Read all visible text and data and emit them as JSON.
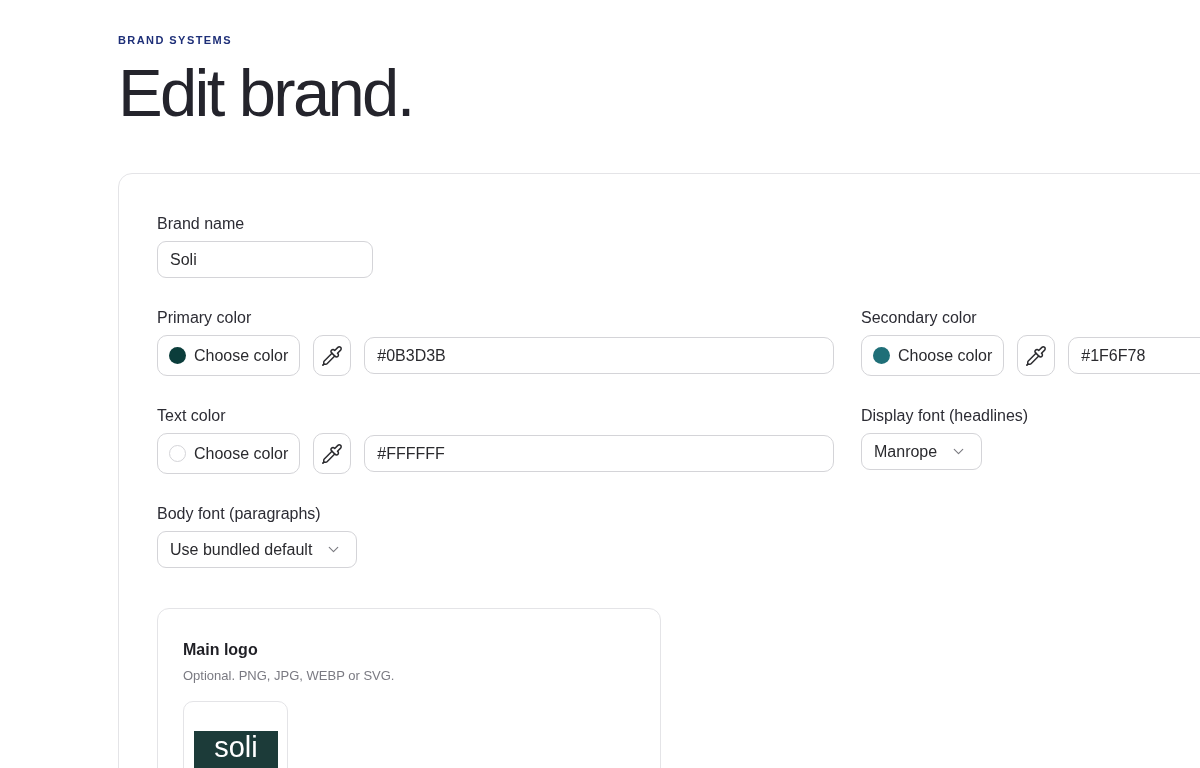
{
  "header": {
    "eyebrow": "BRAND SYSTEMS",
    "title": "Edit brand."
  },
  "form": {
    "rows": [
      [
        {
          "kind": "text",
          "label": "Brand name",
          "value": "Soli"
        }
      ],
      [
        {
          "kind": "color",
          "label": "Primary color",
          "button": "Choose color",
          "color": "#0b3d3b",
          "value": "#0B3D3B"
        },
        {
          "kind": "color",
          "label": "Secondary color",
          "button": "Choose color",
          "color": "#1f6f78",
          "value": "#1F6F78"
        }
      ],
      [
        {
          "kind": "color",
          "label": "Text color",
          "button": "Choose color",
          "color": "#ffffff",
          "value": "#FFFFFF"
        },
        {
          "kind": "select",
          "label": "Display font (headlines)",
          "value": "Manrope"
        }
      ],
      [
        {
          "kind": "select",
          "label": "Body font (paragraphs)",
          "value": "Use bundled default"
        }
      ]
    ],
    "logo": {
      "title": "Main logo",
      "hint": "Optional. PNG, JPG, WEBP or SVG.",
      "preview_text": "soli"
    }
  }
}
